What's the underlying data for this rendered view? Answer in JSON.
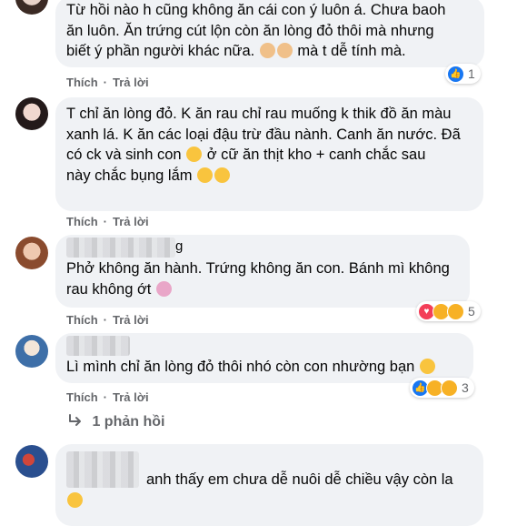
{
  "comments": [
    {
      "text_lines": [
        "Từ hồi nào h cũng không ăn cái con ý luôn á. Chưa baoh",
        "ăn luôn. Ăn trứng cút lộn còn ăn lòng đỏ thôi mà nhưng",
        "biết ý phần người khác nữa.",
        "mà t dễ tính mà."
      ],
      "like": "Thích",
      "reply": "Trả lời",
      "reaction_count": "1"
    },
    {
      "text_lines": [
        "T chỉ ăn lòng đỏ. K ăn rau chỉ rau muống k thik đồ ăn màu",
        "xanh lá. K ăn các loại đậu trừ đầu nành. Canh ăn nước. Đã",
        "có ck và sinh con",
        "ở cữ ăn thịt kho + canh chắc sau",
        "này chắc bụng lắm"
      ],
      "like": "Thích",
      "reply": "Trả lời"
    },
    {
      "name_tail": "g",
      "text_lines": [
        "Phở không ăn hành. Trứng không ăn con. Bánh mì không",
        "rau không ớt"
      ],
      "like": "Thích",
      "reply": "Trả lời",
      "reaction_count": "5"
    },
    {
      "text_lines": [
        "Lì mình chỉ ăn lòng đỏ thôi nhó còn con nhường bạn"
      ],
      "like": "Thích",
      "reply": "Trả lời",
      "reaction_count": "3"
    },
    {
      "text_lines": [
        "anh thấy em chưa dễ nuôi dễ chiều vậy còn la"
      ]
    }
  ],
  "replies_link": "1 phản hồi",
  "icons": {
    "reply_arrow": "reply-arrow-icon"
  },
  "colors": {
    "like_blue": "#1877f2",
    "love_red": "#f33e58",
    "haha_yellow": "#f7b125",
    "bubble": "#f0f2f5",
    "meta_gray": "#65676b"
  }
}
